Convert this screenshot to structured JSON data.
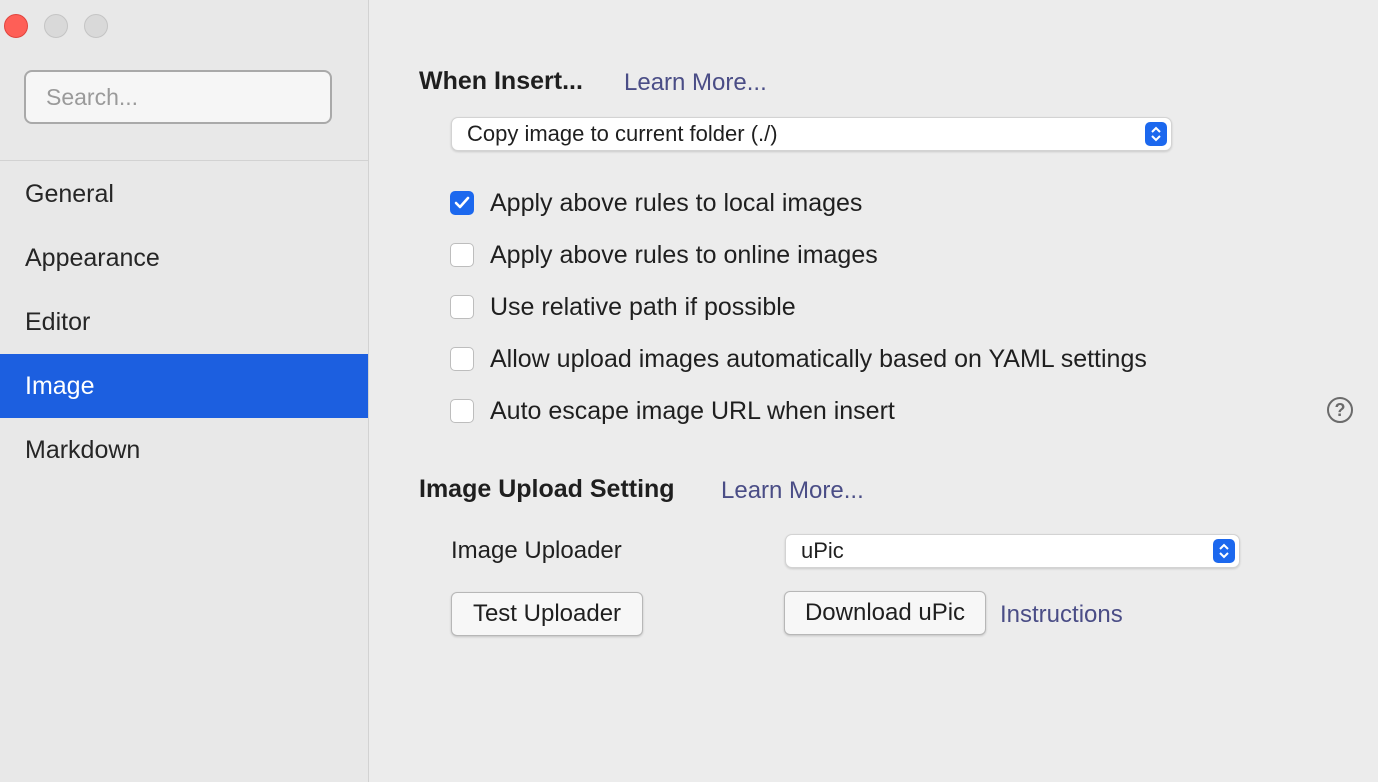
{
  "window": {
    "traffic_lights": [
      "close",
      "minimize",
      "maximize"
    ],
    "colors": {
      "close": "#fe5f57",
      "inactive": "#d9d9d9",
      "accent": "#1c5fe0"
    }
  },
  "sidebar": {
    "search_placeholder": "Search...",
    "items": [
      {
        "label": "General",
        "active": false
      },
      {
        "label": "Appearance",
        "active": false
      },
      {
        "label": "Editor",
        "active": false
      },
      {
        "label": "Image",
        "active": true
      },
      {
        "label": "Markdown",
        "active": false
      }
    ]
  },
  "when_insert": {
    "title": "When Insert...",
    "learn_more": "Learn More...",
    "action_select": "Copy image to current folder (./)",
    "options": [
      {
        "label": "Apply above rules to local images",
        "checked": true
      },
      {
        "label": "Apply above rules to online images",
        "checked": false
      },
      {
        "label": "Use relative path if possible",
        "checked": false
      },
      {
        "label": "Allow upload images automatically based on YAML settings",
        "checked": false
      },
      {
        "label": "Auto escape image URL when insert",
        "checked": false
      }
    ],
    "help_icon": "?"
  },
  "upload_setting": {
    "title": "Image Upload Setting",
    "learn_more": "Learn More...",
    "uploader_label": "Image Uploader",
    "uploader_value": "uPic",
    "test_button": "Test Uploader",
    "download_button": "Download uPic",
    "instructions_link": "Instructions"
  }
}
